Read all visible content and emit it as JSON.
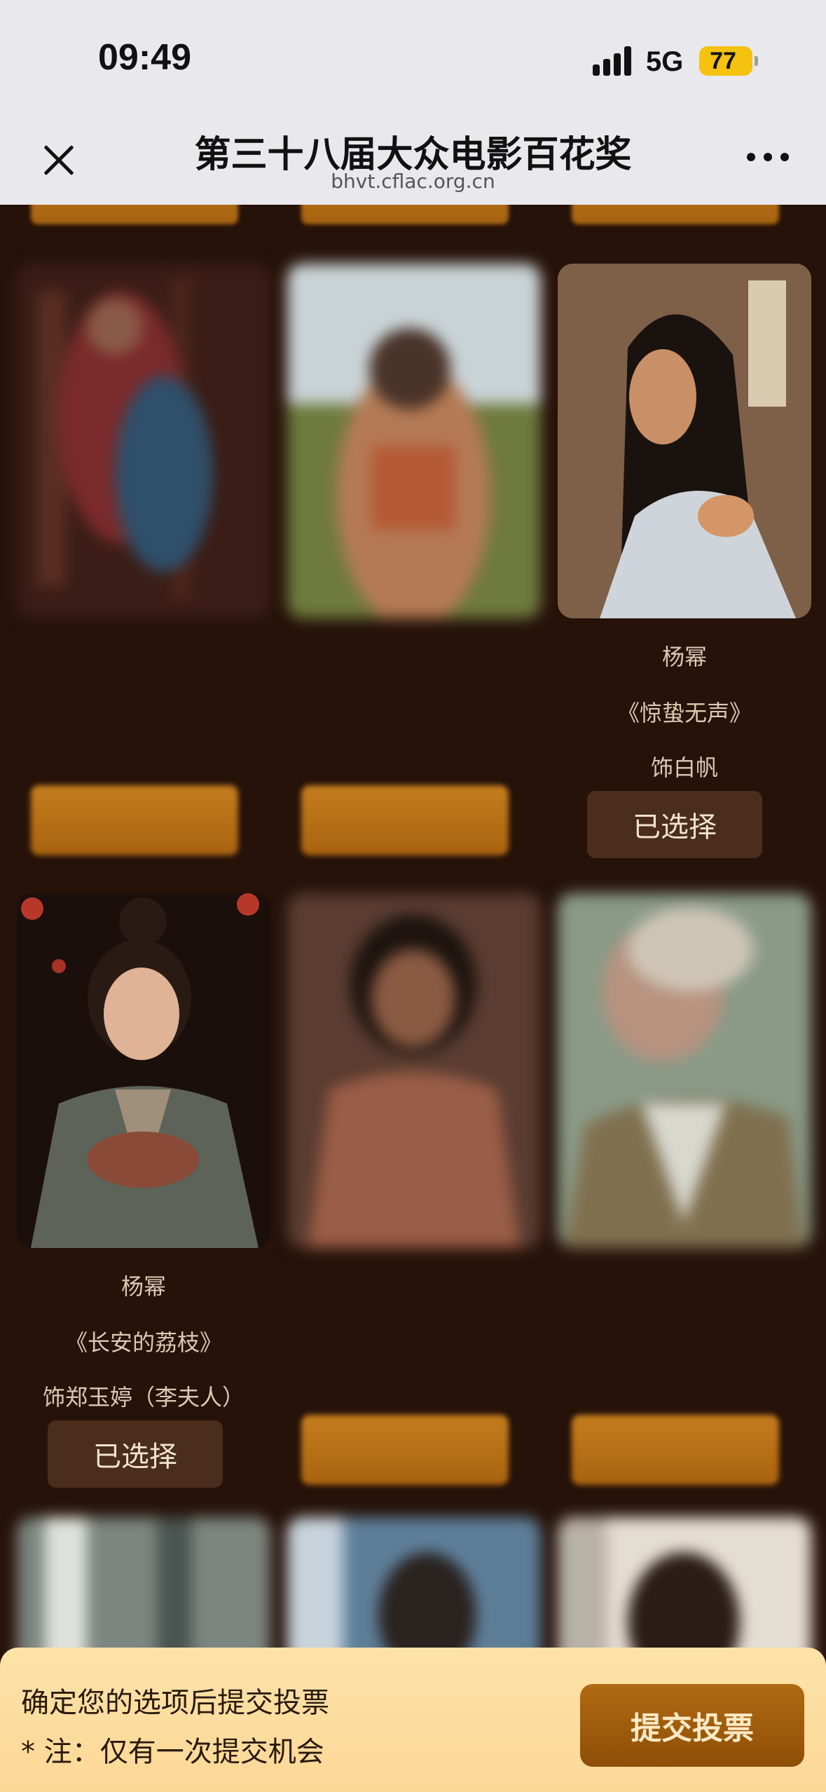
{
  "status_bar": {
    "time": "09:49",
    "network": "5G",
    "battery": "77"
  },
  "nav": {
    "title": "第三十八届大众电影百花奖",
    "url": "bhvt.cflac.org.cn"
  },
  "nominees": [
    {
      "name": "",
      "film": "",
      "role": "",
      "state": "vote",
      "blurred": true
    },
    {
      "name": "",
      "film": "",
      "role": "",
      "state": "vote",
      "blurred": true
    },
    {
      "name": "杨幂",
      "film": "《惊蛰无声》",
      "role": "饰白帆",
      "state": "selected",
      "blurred": false
    },
    {
      "name": "杨幂",
      "film": "《长安的荔枝》",
      "role": "饰郑玉婷（李夫人）",
      "state": "selected",
      "blurred": false
    },
    {
      "name": "",
      "film": "",
      "role": "",
      "state": "vote",
      "blurred": true
    },
    {
      "name": "",
      "film": "",
      "role": "",
      "state": "vote",
      "blurred": true
    }
  ],
  "selected_label": "已选择",
  "footer": {
    "instruction": "确定您的选项后提交投票",
    "note": "* 注：仅有一次提交机会",
    "submit_label": "提交投票"
  },
  "colors": {
    "background": "#261209",
    "accent": "#a9630f",
    "footer_bg": "#fde2a9"
  }
}
